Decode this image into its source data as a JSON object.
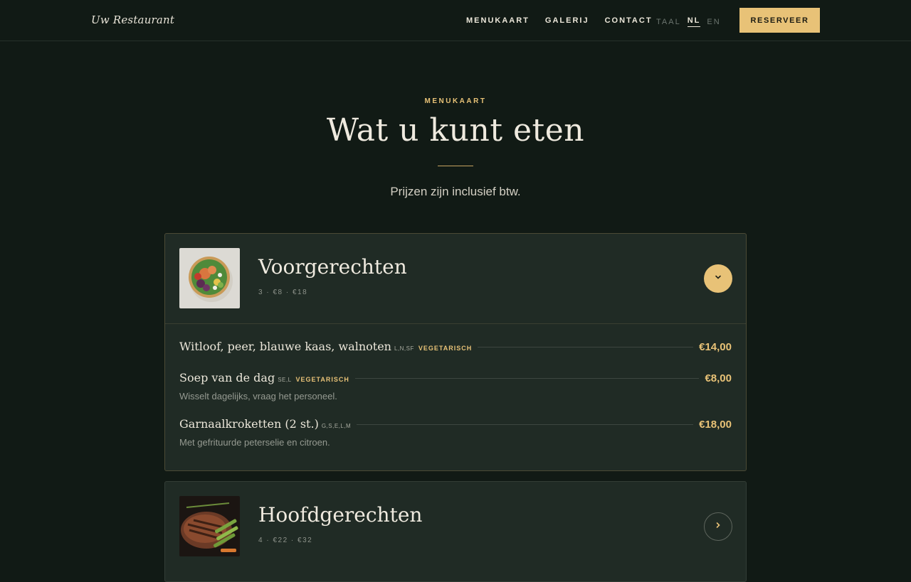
{
  "header": {
    "logo": "Uw Restaurant",
    "nav": [
      "MENUKAART",
      "GALERIJ",
      "CONTACT"
    ],
    "lang_label": "TAAL",
    "langs": [
      "NL",
      "EN"
    ],
    "active_lang": "NL",
    "reserve_label": "RESERVEER"
  },
  "hero": {
    "eyebrow": "MENUKAART",
    "title": "Wat u kunt eten",
    "subtitle": "Prijzen zijn inclusief btw."
  },
  "sections": [
    {
      "title": "Voorgerechten",
      "meta": "3 · €8 · €18",
      "expanded": true,
      "items": [
        {
          "name": "Witloof, peer, blauwe kaas, walnoten",
          "allergens": "L,N,SF",
          "tag": "VEGETARISCH",
          "price": "€14,00",
          "desc": ""
        },
        {
          "name": "Soep van de dag",
          "allergens": "SE,L",
          "tag": "VEGETARISCH",
          "price": "€8,00",
          "desc": "Wisselt dagelijks, vraag het personeel."
        },
        {
          "name": "Garnaalkroketten (2 st.)",
          "allergens": "G,S,E,L,M",
          "tag": "",
          "price": "€18,00",
          "desc": "Met gefrituurde peterselie en citroen."
        }
      ]
    },
    {
      "title": "Hoofdgerechten",
      "meta": "4 · €22 · €32",
      "expanded": false,
      "items": []
    }
  ],
  "colors": {
    "accent": "#e8c277",
    "background": "#111a15",
    "card": "#202b25"
  },
  "icons": {
    "expanded_toggle": "chevron-down-icon",
    "collapsed_toggle": "chevron-right-icon"
  }
}
